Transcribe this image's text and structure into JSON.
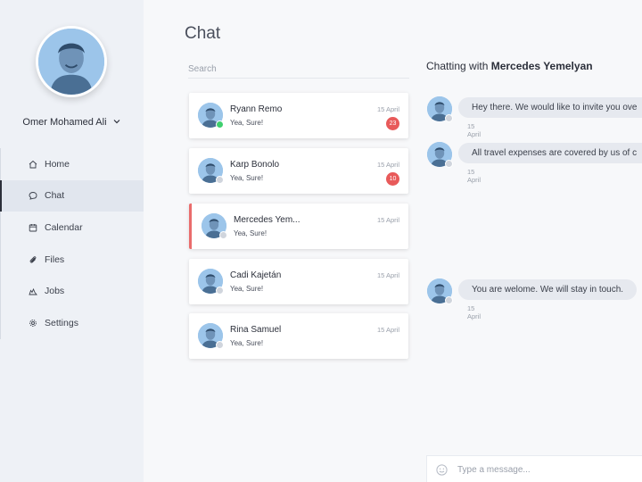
{
  "user": {
    "name": "Omer Mohamed Ali"
  },
  "nav": [
    {
      "label": "Home",
      "icon": "home-icon"
    },
    {
      "label": "Chat",
      "icon": "chat-icon",
      "active": true
    },
    {
      "label": "Calendar",
      "icon": "calendar-icon"
    },
    {
      "label": "Files",
      "icon": "files-icon"
    },
    {
      "label": "Jobs",
      "icon": "jobs-icon"
    },
    {
      "label": "Settings",
      "icon": "settings-icon"
    }
  ],
  "chat": {
    "title": "Chat",
    "search_placeholder": "Search",
    "contacts": [
      {
        "name": "Ryann Remo",
        "preview": "Yea, Sure!",
        "date": "15 April",
        "badge": "23",
        "online": true
      },
      {
        "name": "Karp Bonolo",
        "preview": "Yea, Sure!",
        "date": "15 April",
        "badge": "10",
        "online": false
      },
      {
        "name": "Mercedes Yem...",
        "preview": "Yea, Sure!",
        "date": "15 April",
        "badge": "",
        "online": false,
        "active": true
      },
      {
        "name": "Cadi Kajetán",
        "preview": "Yea, Sure!",
        "date": "15 April",
        "badge": "",
        "online": false
      },
      {
        "name": "Rina Samuel",
        "preview": "Yea, Sure!",
        "date": "15 April",
        "badge": "",
        "online": false
      }
    ]
  },
  "conversation": {
    "prefix": "Chatting with",
    "contact": "Mercedes Yemelyan",
    "messages": [
      {
        "text": "Hey there. We would like to invite you ove",
        "date": "15 April"
      },
      {
        "text": "All travel expenses are covered by us of c",
        "date": "15 April"
      },
      {
        "text": "You are welome. We will stay in touch.",
        "date": "15 April"
      }
    ],
    "composer_placeholder": "Type a message..."
  },
  "colors": {
    "accent_active": "#ea6c6c",
    "badge": "#e85a5a",
    "online": "#3ecf6e",
    "avatar_bg": "#9cc5ea"
  }
}
